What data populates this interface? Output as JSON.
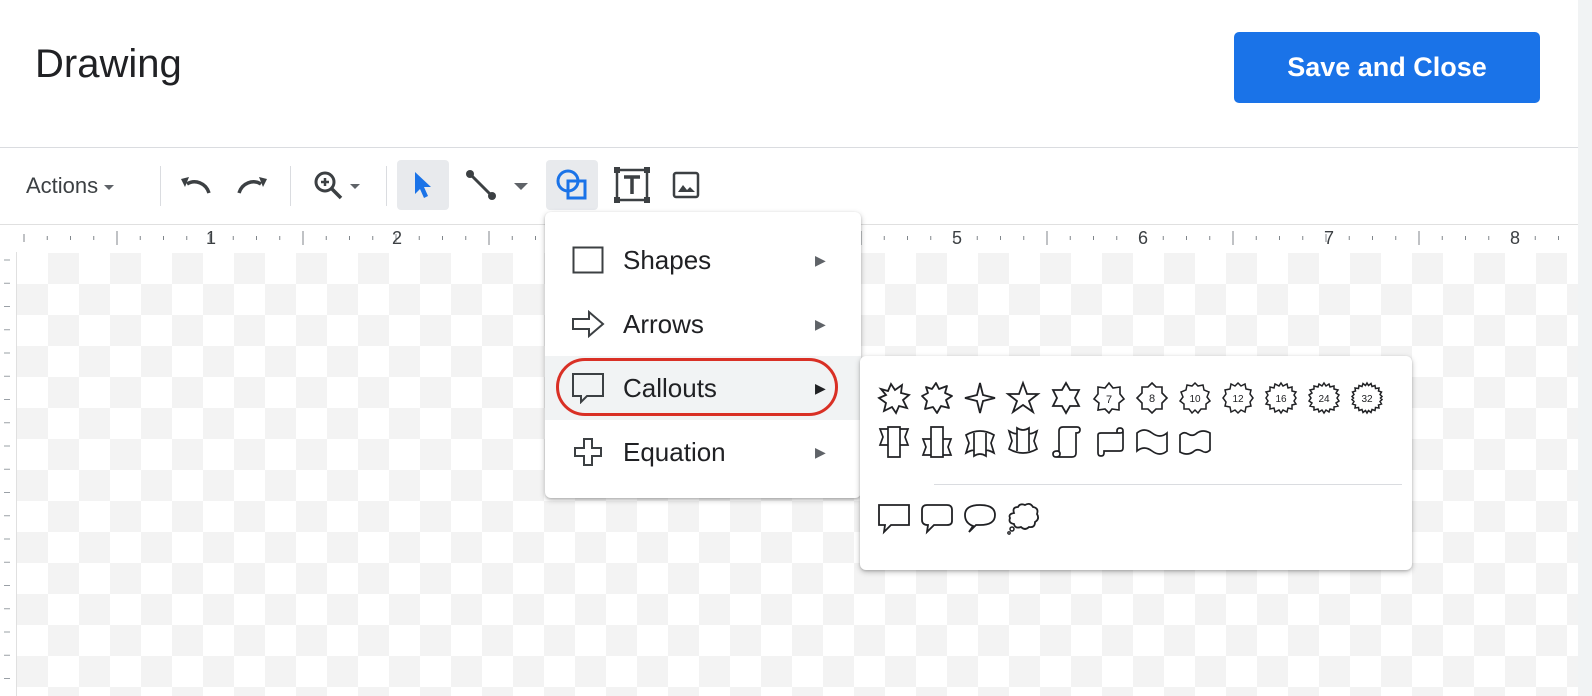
{
  "header": {
    "title": "Drawing",
    "save_label": "Save and Close",
    "accent": "#1a73e8"
  },
  "toolbar": {
    "actions_label": "Actions",
    "icons": [
      "undo-icon",
      "redo-icon",
      "zoom-icon",
      "select-icon",
      "line-icon",
      "shape-icon",
      "textbox-icon",
      "image-icon"
    ]
  },
  "ruler": {
    "numbers": [
      "1",
      "2",
      "5",
      "6",
      "7",
      "8"
    ]
  },
  "menu": {
    "items": [
      {
        "label": "Shapes",
        "arrow": "▶"
      },
      {
        "label": "Arrows",
        "arrow": "▶"
      },
      {
        "label": "Callouts",
        "arrow": "▶"
      },
      {
        "label": "Equation",
        "arrow": "▶"
      }
    ],
    "highlight_color": "#d93025"
  },
  "submenu": {
    "stars_labels": [
      "7",
      "8",
      "10",
      "12",
      "16",
      "24",
      "32"
    ]
  }
}
